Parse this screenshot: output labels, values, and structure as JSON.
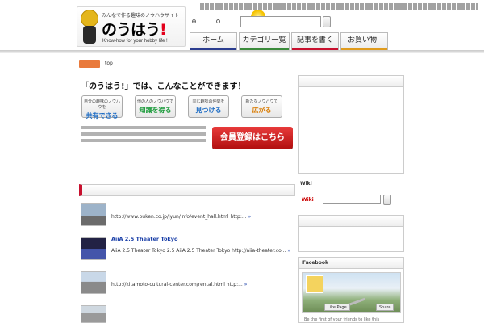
{
  "header": {
    "top_strip_text": "",
    "logo_tagline": "みんなで作る趣味のノウハウサイト",
    "logo_main": "のうはう",
    "logo_bang": "!",
    "logo_sub": "Know-how for your hobby life !"
  },
  "search": {
    "option_1": "",
    "option_2": "",
    "value": "",
    "placeholder": ""
  },
  "nav": {
    "tabs": [
      {
        "label": "ホーム",
        "bar": "#2a3c8e"
      },
      {
        "label": "カテゴリ一覧",
        "bar": "#3a8a3a"
      },
      {
        "label": "記事を書く",
        "bar": "#c8102e"
      },
      {
        "label": "お買い物",
        "badge": "",
        "bar": "#e09b1c"
      }
    ]
  },
  "breadcrumb": {
    "here": "",
    "path": " top"
  },
  "feature": {
    "title_quote_open": "「",
    "title_quote_close": "」",
    "title_name": "のうはう!",
    "title_rest": "では、こんなことができます！",
    "buttons": [
      {
        "small": "自分の趣味のノウハウを",
        "big": "共有できる",
        "color": "#1b6bc4"
      },
      {
        "small": "他の人のノウハウで",
        "big": "知識を得る",
        "color": "#1a9a3a"
      },
      {
        "small": "同じ趣味の仲間を",
        "big": "見つける",
        "color": "#1b6bc4"
      },
      {
        "small": "新たなノウハウで",
        "big": "広がる",
        "color": "#d97b00"
      }
    ],
    "description": "",
    "signup_label": "会員登録はこちら"
  },
  "articles": {
    "section_title": "",
    "items": [
      {
        "title": "",
        "meta": "",
        "excerpt": "http://www.buken.co.jp/jyun/info/event_hall.html http:...",
        "more": "»",
        "thumb_top": "#9db3c9",
        "thumb_bottom": "#6b6b6b"
      },
      {
        "title": "AiiA 2.5 Theater Tokyo",
        "meta": "",
        "excerpt": "AiiA 2.5 Theater Tokyo 2.5 AiiA 2.5 Theater Tokyo http://aiia-theater.co...",
        "more": "»",
        "thumb_top": "#222244",
        "thumb_bottom": "#4455aa"
      },
      {
        "title": "",
        "meta": "",
        "excerpt": "http://kitamoto-cultural-center.com/rental.html http:...",
        "more": "»",
        "thumb_top": "#c9d8e8",
        "thumb_bottom": "#8a8a8a"
      },
      {
        "title": "",
        "meta": "",
        "excerpt": "",
        "more": "",
        "thumb_top": "#cfd8e0",
        "thumb_bottom": "#9a9a9a"
      }
    ]
  },
  "sidebar": {
    "box1_title": "",
    "wiki_title": "Wiki",
    "wiki_label": "Wiki",
    "wiki_value": "",
    "links_title": "",
    "links": [
      "",
      "",
      "",
      ""
    ],
    "facebook_title": "Facebook",
    "fb_like": "Like Page",
    "fb_share": "Share",
    "fb_footer": "Be the first of your friends to like this"
  }
}
